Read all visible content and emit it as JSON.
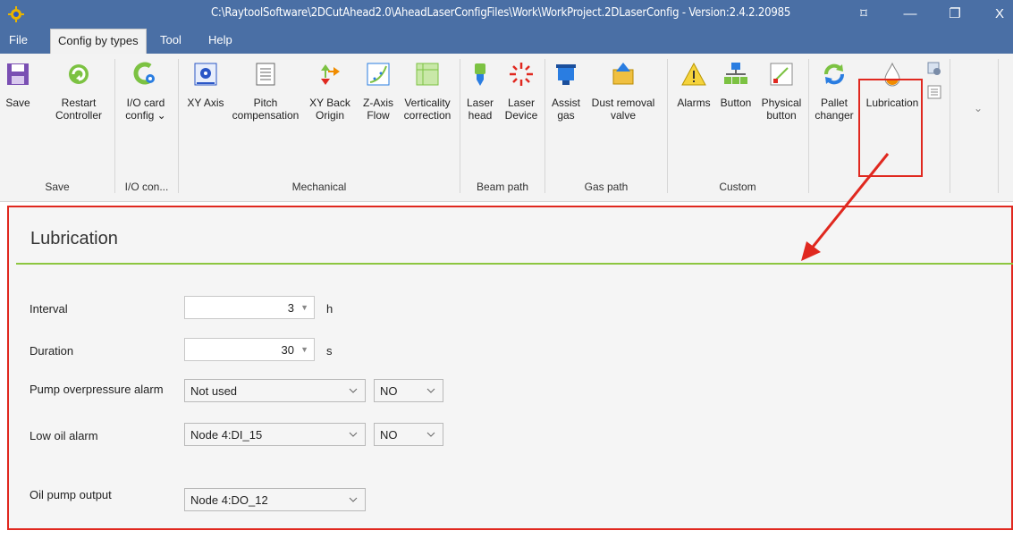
{
  "window": {
    "title": "C:\\RaytoolSoftware\\2DCutAhead2.0\\AheadLaserConfigFiles\\Work\\WorkProject.2DLaserConfig - Version:2.4.2.20985",
    "restore_glyph": "⌑",
    "minimize_glyph": "—",
    "maximize_glyph": "❐",
    "close_glyph": "X"
  },
  "menu": {
    "file": "File",
    "config_by_types": "Config by types",
    "tool": "Tool",
    "help": "Help"
  },
  "ribbon": {
    "save": "Save",
    "restart_controller": "Restart\nController",
    "io_card_config": "I/O card\nconfig ⌄",
    "xy_axis": "XY Axis",
    "pitch_compensation": "Pitch\ncompensation",
    "xy_back_origin": "XY Back\nOrigin",
    "z_axis_flow": "Z-Axis\nFlow",
    "verticality_correction": "Verticality\ncorrection",
    "laser_head": "Laser\nhead",
    "laser_device": "Laser\nDevice",
    "assist_gas": "Assist\ngas",
    "dust_removal_valve": "Dust removal\nvalve",
    "alarms": "Alarms",
    "button": "Button",
    "physical_button": "Physical\nbutton",
    "pallet_changer": "Pallet\nchanger",
    "lubrication": "Lubrication",
    "more": "⌄",
    "groups": {
      "save": "Save",
      "io": "I/O con...",
      "mechanical": "Mechanical",
      "beam_path": "Beam path",
      "gas_path": "Gas path",
      "custom": "Custom"
    }
  },
  "panel": {
    "title": "Lubrication",
    "interval_label": "Interval",
    "interval_value": "3",
    "interval_unit": "h",
    "duration_label": "Duration",
    "duration_value": "30",
    "duration_unit": "s",
    "pump_overpressure_label": "Pump overpressure alarm",
    "pump_overpressure_value": "Not used",
    "pump_overpressure_mode": "NO",
    "low_oil_label": "Low oil alarm",
    "low_oil_value": "Node 4:DI_15",
    "low_oil_mode": "NO",
    "oil_pump_label": "Oil pump output",
    "oil_pump_value": "Node 4:DO_12",
    "spin_arrow": "▼"
  },
  "colors": {
    "titlebar": "#4a6fa5",
    "highlight": "#e0281f",
    "title_underline": "#8dc63f"
  }
}
